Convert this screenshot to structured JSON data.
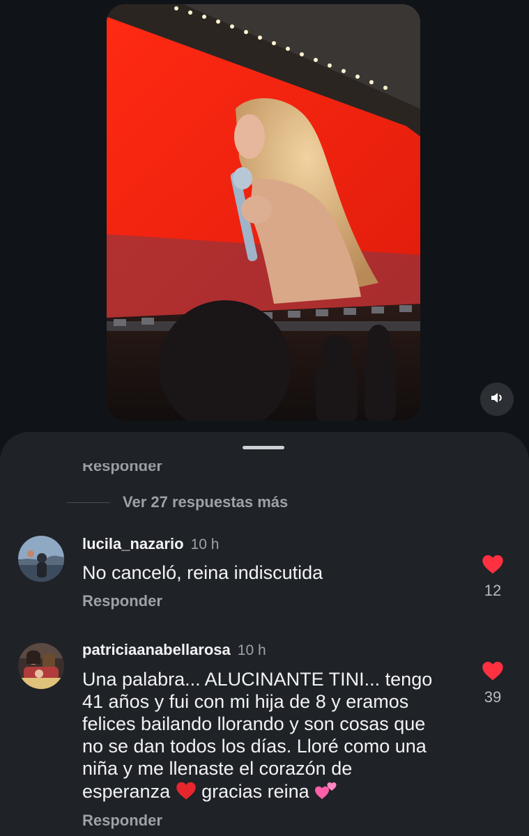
{
  "sheet": {
    "partial_reply_label": "Responder",
    "more_replies_label": "Ver 27 respuestas más"
  },
  "comments": [
    {
      "username": "lucila_nazario",
      "time": "10 h",
      "text": "No canceló, reina indiscutida",
      "reply_label": "Responder",
      "likes": "12",
      "liked": true
    },
    {
      "username": "patriciaanabellarosa",
      "time": "10 h",
      "text_lines": [
        "Una palabra... ALUCINANTE TINI... tengo",
        "41 años y fui con mi hija de 8 y eramos",
        "felices bailando llorando y son cosas que",
        "no se dan todos los días. Lloré como una",
        "niña y me llenaste el corazón de"
      ],
      "text_last_a": "esperanza",
      "text_last_b": "gracias reina",
      "emoji_1": "red-heart-emoji",
      "emoji_2": "two-hearts-emoji",
      "reply_label": "Responder",
      "likes": "39",
      "liked": true
    }
  ],
  "icons": {
    "mute": "speaker-icon",
    "like": "heart-icon"
  },
  "colors": {
    "background": "#101317",
    "sheet": "#1f2226",
    "like_red": "#ff3040",
    "muted_text": "#9ea2a8"
  }
}
